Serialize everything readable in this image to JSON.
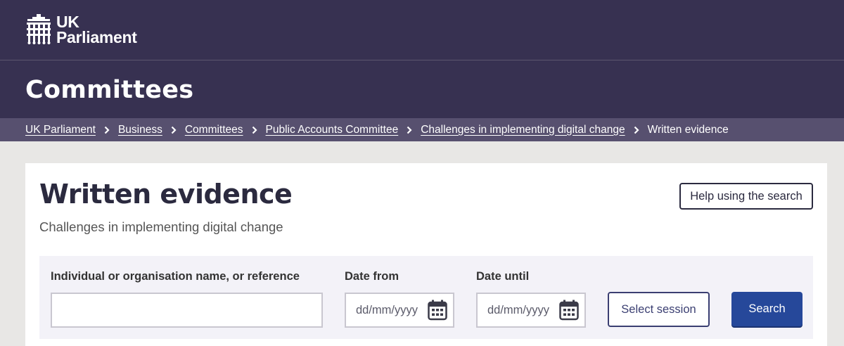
{
  "header": {
    "logo_line1": "UK",
    "logo_line2": "Parliament",
    "logo_icon": "portcullis-icon"
  },
  "section": {
    "title": "Committees"
  },
  "breadcrumb": {
    "items": [
      "UK Parliament",
      "Business",
      "Committees",
      "Public Accounts Committee",
      "Challenges in implementing digital change"
    ],
    "current": "Written evidence",
    "separator_icon": "chevron-right-icon"
  },
  "main": {
    "title": "Written evidence",
    "subtitle": "Challenges in implementing digital change",
    "help_button": "Help using the search"
  },
  "filters": {
    "name_label": "Individual or organisation name, or reference",
    "name_value": "",
    "date_from_label": "Date from",
    "date_from_placeholder": "dd/mm/yyyy",
    "date_until_label": "Date until",
    "date_until_placeholder": "dd/mm/yyyy",
    "calendar_icon": "calendar-icon",
    "select_session_button": "Select session",
    "search_button": "Search"
  },
  "colors": {
    "header_bg": "#373151",
    "breadcrumb_bg": "#57506f",
    "page_bg": "#e8e7e5",
    "filter_bg": "#f3f2f8",
    "primary_button": "#26489a"
  }
}
